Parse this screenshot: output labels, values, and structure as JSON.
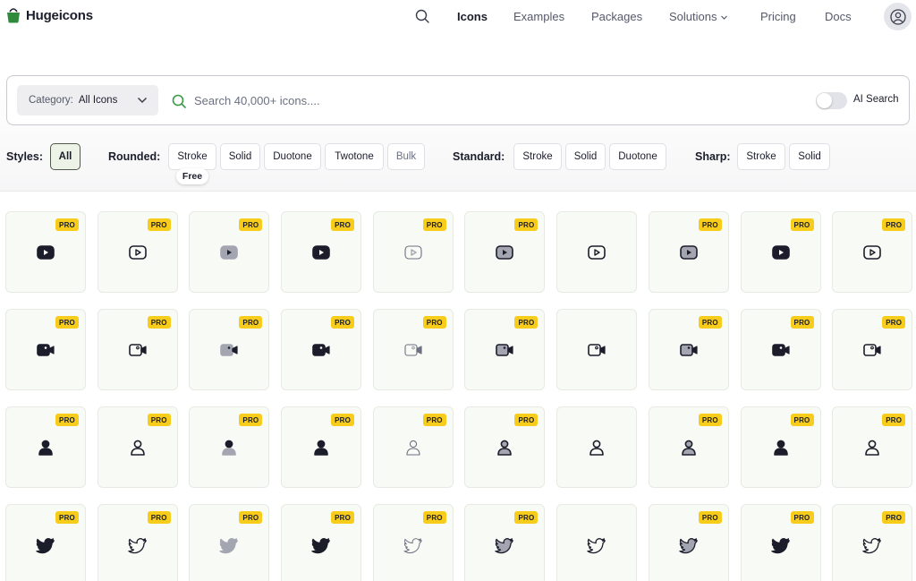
{
  "brand": {
    "name": "Hugeicons"
  },
  "nav": {
    "items": [
      {
        "label": "Icons",
        "active": true
      },
      {
        "label": "Examples",
        "active": false
      },
      {
        "label": "Packages",
        "active": false
      },
      {
        "label": "Solutions",
        "active": false,
        "dropdown": true
      },
      {
        "label": "Pricing",
        "active": false
      },
      {
        "label": "Docs",
        "active": false
      }
    ]
  },
  "search": {
    "category_label": "Category:",
    "category_value": "All Icons",
    "placeholder": "Search 40,000+ icons....",
    "ai_search_label": "AI Search",
    "ai_search_enabled": false
  },
  "styles": {
    "label": "Styles:",
    "all": "All",
    "rounded": {
      "label": "Rounded:",
      "options": [
        "Stroke",
        "Solid",
        "Duotone",
        "Twotone",
        "Bulk"
      ],
      "free_tag": "Free"
    },
    "standard": {
      "label": "Standard:",
      "options": [
        "Stroke",
        "Solid",
        "Duotone"
      ]
    },
    "sharp": {
      "label": "Sharp:",
      "options": [
        "Stroke",
        "Solid"
      ]
    }
  },
  "grid": {
    "badge": "PRO",
    "rows": [
      {
        "icon": "youtube-icon",
        "variants": [
          "solid",
          "stroke",
          "bulk",
          "solid",
          "twotone",
          "duotone",
          "stroke",
          "duotone",
          "solid",
          "stroke"
        ],
        "pro": [
          true,
          true,
          true,
          true,
          true,
          true,
          false,
          true,
          true,
          true
        ]
      },
      {
        "icon": "video-camera-icon",
        "variants": [
          "solid",
          "stroke",
          "bulk",
          "solid",
          "twotone",
          "duotone",
          "stroke",
          "duotone",
          "solid",
          "stroke"
        ],
        "pro": [
          true,
          true,
          true,
          true,
          true,
          true,
          false,
          true,
          true,
          true
        ]
      },
      {
        "icon": "user-icon",
        "variants": [
          "solid",
          "stroke",
          "bulk",
          "solid",
          "twotone",
          "duotone",
          "stroke",
          "duotone",
          "solid",
          "stroke"
        ],
        "pro": [
          true,
          true,
          true,
          true,
          true,
          true,
          false,
          true,
          true,
          true
        ]
      },
      {
        "icon": "twitter-icon",
        "variants": [
          "solid",
          "stroke",
          "bulk",
          "solid",
          "twotone",
          "duotone",
          "stroke",
          "duotone",
          "solid",
          "stroke"
        ],
        "pro": [
          true,
          true,
          true,
          true,
          true,
          true,
          false,
          true,
          true,
          true
        ]
      }
    ]
  },
  "colors": {
    "dark": "#1b1d2b",
    "gray": "#a3a6b0",
    "pro_badge": "#f7cc1a",
    "tile_bg": "#f8fbf5"
  }
}
